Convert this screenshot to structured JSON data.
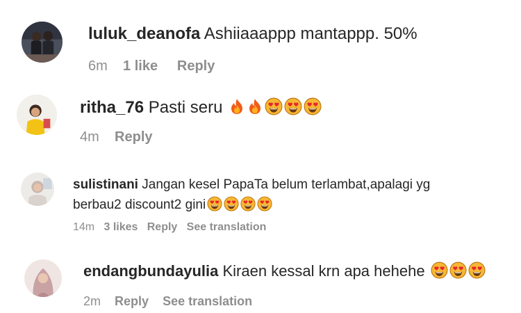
{
  "comments": [
    {
      "username": "luluk_deanofa",
      "text": "Ashiiaaappp mantappp. 50%",
      "emojis": [],
      "time": "6m",
      "likes": "1 like",
      "reply": "Reply",
      "translation": ""
    },
    {
      "username": "ritha_76",
      "text": "Pasti seru",
      "emojis": [
        "fire-emoji",
        "fire-emoji",
        "heart-eyes-emoji",
        "heart-eyes-emoji",
        "heart-eyes-emoji"
      ],
      "time": "4m",
      "likes": "",
      "reply": "Reply",
      "translation": ""
    },
    {
      "username": "sulistinani",
      "text_line1": "Jangan kesel PapaTa belum terlambat,apalagi yg",
      "text_line2": "berbau2 discount2 gini",
      "emojis": [
        "heart-eyes-emoji",
        "heart-eyes-emoji",
        "heart-eyes-emoji",
        "heart-eyes-emoji"
      ],
      "time": "14m",
      "likes": "3 likes",
      "reply": "Reply",
      "translation": "See translation"
    },
    {
      "username": "endangbundayulia",
      "text": "Kiraen kessal krn apa hehehe",
      "emojis": [
        "heart-eyes-emoji",
        "heart-eyes-emoji",
        "heart-eyes-emoji"
      ],
      "time": "2m",
      "likes": "",
      "reply": "Reply",
      "translation": "See translation"
    }
  ],
  "colors": {
    "text": "#262626",
    "meta": "#8e8e8e",
    "background": "#ffffff"
  }
}
